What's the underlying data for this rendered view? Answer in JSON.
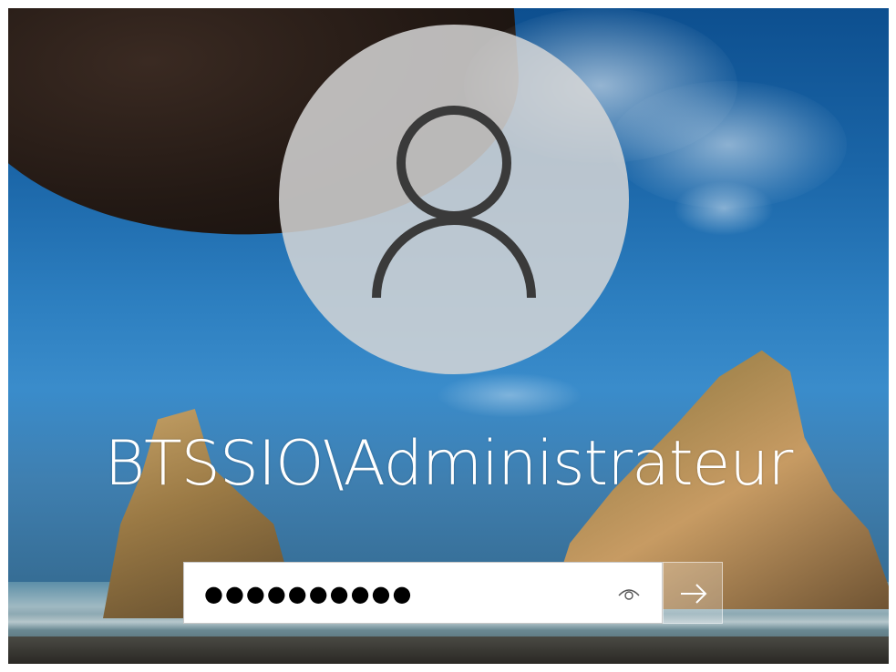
{
  "login": {
    "username": "BTSSIO\\Administrateur",
    "password_masked": "●●●●●●●●●●"
  },
  "icons": {
    "avatar": "user-avatar-icon",
    "reveal": "eye-icon",
    "submit": "arrow-right-icon"
  },
  "colors": {
    "avatar_circle": "#d6d6d6",
    "avatar_glyph": "#3a3a3a",
    "text": "#ffffff",
    "input_background": "#ffffff"
  }
}
